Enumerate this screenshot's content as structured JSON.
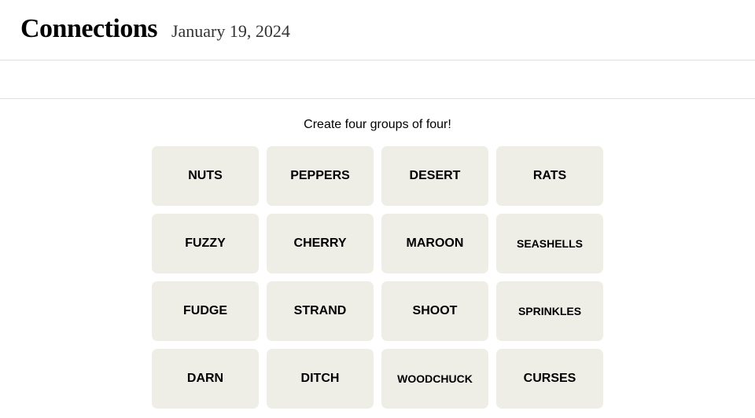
{
  "header": {
    "title": "Connections",
    "date": "January 19, 2024"
  },
  "instruction": "Create four groups of four!",
  "tiles": [
    "NUTS",
    "PEPPERS",
    "DESERT",
    "RATS",
    "FUZZY",
    "CHERRY",
    "MAROON",
    "SEASHELLS",
    "FUDGE",
    "STRAND",
    "SHOOT",
    "SPRINKLES",
    "DARN",
    "DITCH",
    "WOODCHUCK",
    "CURSES"
  ]
}
